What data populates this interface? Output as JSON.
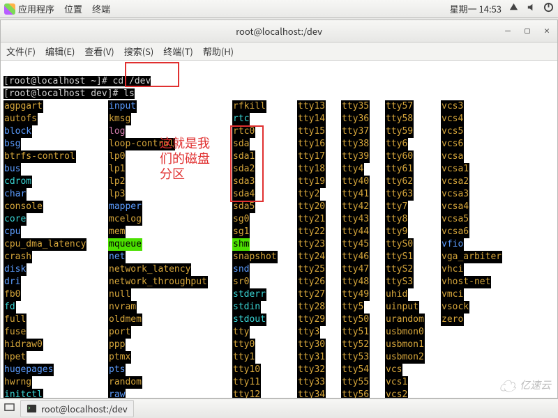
{
  "panel": {
    "menus": [
      "应用程序",
      "位置",
      "终端"
    ],
    "clock": "星期一  14:53"
  },
  "window": {
    "title": "root@localhost:/dev",
    "menubar": [
      "文件(F)",
      "编辑(E)",
      "查看(V)",
      "搜索(S)",
      "终端(T)",
      "帮助(H)"
    ]
  },
  "prompt": {
    "line1_pre": "[root@localhost ~]# ",
    "line1_cmd": "cd /dev",
    "line2_pre": "[root@localhost dev]# ",
    "line2_cmd": "ls"
  },
  "annotation": "这就是我\n们的磁盘\n分区",
  "cols": {
    "c1": [
      {
        "t": "agpgart",
        "k": "dev"
      },
      {
        "t": "autofs",
        "k": "dev"
      },
      {
        "t": "block",
        "k": "dir"
      },
      {
        "t": "bsg",
        "k": "dir"
      },
      {
        "t": "btrfs-control",
        "k": "dev"
      },
      {
        "t": "bus",
        "k": "dir"
      },
      {
        "t": "cdrom",
        "k": "link"
      },
      {
        "t": "char",
        "k": "dir"
      },
      {
        "t": "console",
        "k": "dev"
      },
      {
        "t": "core",
        "k": "link"
      },
      {
        "t": "cpu",
        "k": "dir"
      },
      {
        "t": "cpu_dma_latency",
        "k": "dev"
      },
      {
        "t": "crash",
        "k": "dev"
      },
      {
        "t": "disk",
        "k": "dir"
      },
      {
        "t": "dri",
        "k": "dir"
      },
      {
        "t": "fb0",
        "k": "dev"
      },
      {
        "t": "fd",
        "k": "link"
      },
      {
        "t": "full",
        "k": "dev"
      },
      {
        "t": "fuse",
        "k": "dev"
      },
      {
        "t": "hidraw0",
        "k": "dev"
      },
      {
        "t": "hpet",
        "k": "dev"
      },
      {
        "t": "hugepages",
        "k": "dir"
      },
      {
        "t": "hwrng",
        "k": "dev"
      },
      {
        "t": "initctl",
        "k": "link"
      }
    ],
    "c2": [
      {
        "t": "input",
        "k": "dir"
      },
      {
        "t": "kmsg",
        "k": "dev"
      },
      {
        "t": "log",
        "k": "pink"
      },
      {
        "t": "loop-control",
        "k": "dev"
      },
      {
        "t": "lp0",
        "k": "dev"
      },
      {
        "t": "lp1",
        "k": "dev"
      },
      {
        "t": "lp2",
        "k": "dev"
      },
      {
        "t": "lp3",
        "k": "dev"
      },
      {
        "t": "mapper",
        "k": "dir"
      },
      {
        "t": "mcelog",
        "k": "dev"
      },
      {
        "t": "mem",
        "k": "dev"
      },
      {
        "t": "mqueue",
        "k": "green"
      },
      {
        "t": "net",
        "k": "dir"
      },
      {
        "t": "network_latency",
        "k": "dev"
      },
      {
        "t": "network_throughput",
        "k": "dev"
      },
      {
        "t": "null",
        "k": "dev"
      },
      {
        "t": "nvram",
        "k": "dev"
      },
      {
        "t": "oldmem",
        "k": "dev"
      },
      {
        "t": "port",
        "k": "dev"
      },
      {
        "t": "ppp",
        "k": "dev"
      },
      {
        "t": "ptmx",
        "k": "dev"
      },
      {
        "t": "pts",
        "k": "dir"
      },
      {
        "t": "random",
        "k": "dev"
      },
      {
        "t": "raw",
        "k": "dir"
      }
    ],
    "c3": [
      {
        "t": "rfkill",
        "k": "dev"
      },
      {
        "t": "rtc",
        "k": "link"
      },
      {
        "t": "rtc0",
        "k": "dev"
      },
      {
        "t": "sda",
        "k": "dev"
      },
      {
        "t": "sda1",
        "k": "dev"
      },
      {
        "t": "sda2",
        "k": "dev"
      },
      {
        "t": "sda3",
        "k": "dev"
      },
      {
        "t": "sda4",
        "k": "dev"
      },
      {
        "t": "sda5",
        "k": "dev"
      },
      {
        "t": "sg0",
        "k": "dev"
      },
      {
        "t": "sg1",
        "k": "dev"
      },
      {
        "t": "shm",
        "k": "green"
      },
      {
        "t": "snapshot",
        "k": "dev"
      },
      {
        "t": "snd",
        "k": "dir"
      },
      {
        "t": "sr0",
        "k": "dev"
      },
      {
        "t": "stderr",
        "k": "link"
      },
      {
        "t": "stdin",
        "k": "link"
      },
      {
        "t": "stdout",
        "k": "link"
      },
      {
        "t": "tty",
        "k": "dev"
      },
      {
        "t": "tty0",
        "k": "dev"
      },
      {
        "t": "tty1",
        "k": "dev"
      },
      {
        "t": "tty10",
        "k": "dev"
      },
      {
        "t": "tty11",
        "k": "dev"
      },
      {
        "t": "tty12",
        "k": "dev"
      }
    ],
    "c4": [
      {
        "t": "tty13",
        "k": "dev"
      },
      {
        "t": "tty14",
        "k": "dev"
      },
      {
        "t": "tty15",
        "k": "dev"
      },
      {
        "t": "tty16",
        "k": "dev"
      },
      {
        "t": "tty17",
        "k": "dev"
      },
      {
        "t": "tty18",
        "k": "dev"
      },
      {
        "t": "tty19",
        "k": "dev"
      },
      {
        "t": "tty2",
        "k": "dev"
      },
      {
        "t": "tty20",
        "k": "dev"
      },
      {
        "t": "tty21",
        "k": "dev"
      },
      {
        "t": "tty22",
        "k": "dev"
      },
      {
        "t": "tty23",
        "k": "dev"
      },
      {
        "t": "tty24",
        "k": "dev"
      },
      {
        "t": "tty25",
        "k": "dev"
      },
      {
        "t": "tty26",
        "k": "dev"
      },
      {
        "t": "tty27",
        "k": "dev"
      },
      {
        "t": "tty28",
        "k": "dev"
      },
      {
        "t": "tty29",
        "k": "dev"
      },
      {
        "t": "tty3",
        "k": "dev"
      },
      {
        "t": "tty30",
        "k": "dev"
      },
      {
        "t": "tty31",
        "k": "dev"
      },
      {
        "t": "tty32",
        "k": "dev"
      },
      {
        "t": "tty33",
        "k": "dev"
      },
      {
        "t": "tty34",
        "k": "dev"
      }
    ],
    "c5": [
      {
        "t": "tty35",
        "k": "dev"
      },
      {
        "t": "tty36",
        "k": "dev"
      },
      {
        "t": "tty37",
        "k": "dev"
      },
      {
        "t": "tty38",
        "k": "dev"
      },
      {
        "t": "tty39",
        "k": "dev"
      },
      {
        "t": "tty4",
        "k": "dev"
      },
      {
        "t": "tty40",
        "k": "dev"
      },
      {
        "t": "tty41",
        "k": "dev"
      },
      {
        "t": "tty42",
        "k": "dev"
      },
      {
        "t": "tty43",
        "k": "dev"
      },
      {
        "t": "tty44",
        "k": "dev"
      },
      {
        "t": "tty45",
        "k": "dev"
      },
      {
        "t": "tty46",
        "k": "dev"
      },
      {
        "t": "tty47",
        "k": "dev"
      },
      {
        "t": "tty48",
        "k": "dev"
      },
      {
        "t": "tty49",
        "k": "dev"
      },
      {
        "t": "tty5",
        "k": "dev"
      },
      {
        "t": "tty50",
        "k": "dev"
      },
      {
        "t": "tty51",
        "k": "dev"
      },
      {
        "t": "tty52",
        "k": "dev"
      },
      {
        "t": "tty53",
        "k": "dev"
      },
      {
        "t": "tty54",
        "k": "dev"
      },
      {
        "t": "tty55",
        "k": "dev"
      },
      {
        "t": "tty56",
        "k": "dev"
      }
    ],
    "c6": [
      {
        "t": "tty57",
        "k": "dev"
      },
      {
        "t": "tty58",
        "k": "dev"
      },
      {
        "t": "tty59",
        "k": "dev"
      },
      {
        "t": "tty6",
        "k": "dev"
      },
      {
        "t": "tty60",
        "k": "dev"
      },
      {
        "t": "tty61",
        "k": "dev"
      },
      {
        "t": "tty62",
        "k": "dev"
      },
      {
        "t": "tty63",
        "k": "dev"
      },
      {
        "t": "tty7",
        "k": "dev"
      },
      {
        "t": "tty8",
        "k": "dev"
      },
      {
        "t": "tty9",
        "k": "dev"
      },
      {
        "t": "ttyS0",
        "k": "dev"
      },
      {
        "t": "ttyS1",
        "k": "dev"
      },
      {
        "t": "ttyS2",
        "k": "dev"
      },
      {
        "t": "ttyS3",
        "k": "dev"
      },
      {
        "t": "uhid",
        "k": "dev"
      },
      {
        "t": "uinput",
        "k": "dev"
      },
      {
        "t": "urandom",
        "k": "dev"
      },
      {
        "t": "usbmon0",
        "k": "dev"
      },
      {
        "t": "usbmon1",
        "k": "dev"
      },
      {
        "t": "usbmon2",
        "k": "dev"
      },
      {
        "t": "vcs",
        "k": "dev"
      },
      {
        "t": "vcs1",
        "k": "dev"
      },
      {
        "t": "vcs2",
        "k": "dev"
      }
    ],
    "c7": [
      {
        "t": "vcs3",
        "k": "dev"
      },
      {
        "t": "vcs4",
        "k": "dev"
      },
      {
        "t": "vcs5",
        "k": "dev"
      },
      {
        "t": "vcs6",
        "k": "dev"
      },
      {
        "t": "vcsa",
        "k": "dev"
      },
      {
        "t": "vcsa1",
        "k": "dev"
      },
      {
        "t": "vcsa2",
        "k": "dev"
      },
      {
        "t": "vcsa3",
        "k": "dev"
      },
      {
        "t": "vcsa4",
        "k": "dev"
      },
      {
        "t": "vcsa5",
        "k": "dev"
      },
      {
        "t": "vcsa6",
        "k": "dev"
      },
      {
        "t": "vfio",
        "k": "dir"
      },
      {
        "t": "vga_arbiter",
        "k": "dev"
      },
      {
        "t": "vhci",
        "k": "dev"
      },
      {
        "t": "vhost-net",
        "k": "dev"
      },
      {
        "t": "vmci",
        "k": "dev"
      },
      {
        "t": "vsock",
        "k": "dev"
      },
      {
        "t": "zero",
        "k": "dev"
      }
    ]
  },
  "taskbar": {
    "task1": "root@localhost:/dev"
  },
  "watermark": "亿速云"
}
